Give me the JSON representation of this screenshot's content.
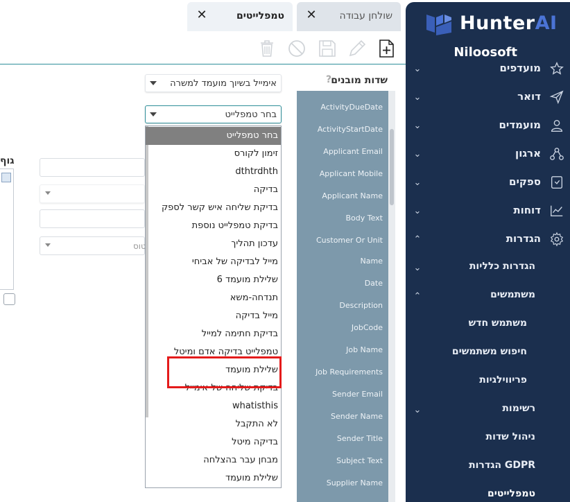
{
  "tabs": [
    {
      "label": "שולחן עבודה",
      "close": "✕"
    },
    {
      "label": "טמפלייטים",
      "close": "✕"
    }
  ],
  "sidebar": {
    "brand": {
      "hunter": "Hunter",
      "ai": "AI"
    },
    "company": "Niloosoft",
    "items": [
      {
        "label": "מועדפים",
        "icon": "star-icon"
      },
      {
        "label": "דואר",
        "icon": "send-icon"
      },
      {
        "label": "מועמדים",
        "icon": "user-icon"
      },
      {
        "label": "ארגון",
        "icon": "org-icon"
      },
      {
        "label": "ספקים",
        "icon": "supplier-icon"
      },
      {
        "label": "דוחות",
        "icon": "chart-icon"
      },
      {
        "label": "הגדרות",
        "icon": "gear-icon"
      },
      {
        "label": "הגדרות כלליות"
      },
      {
        "label": "משתמשים"
      },
      {
        "label": "משתמש חדש"
      },
      {
        "label": "חיפוש משתמשים"
      },
      {
        "label": "פריווילגיות"
      },
      {
        "label": "רשימות"
      },
      {
        "label": "ניהול שדות"
      },
      {
        "label": "הגדרות GDPR"
      },
      {
        "label": "טמפלייטים"
      }
    ]
  },
  "fields": {
    "title": "שדות מובנים",
    "help": "?",
    "items": [
      "ActivityDueDate",
      "ActivityStartDate",
      "Applicant Email",
      "Applicant Mobile",
      "Applicant Name",
      "Body Text",
      "Customer Or Unit",
      "Name",
      "Date",
      "Description",
      "JobCode",
      "Job Name",
      "Job Requirements",
      "Sender Email",
      "Sender Name",
      "Sender Title",
      "Subject Text",
      "Supplier Name"
    ]
  },
  "form": {
    "email_type": "אימייל בשיוך מועמד למשרה",
    "template_select": "בחר טמפלייט",
    "body_label": "גוף",
    "ghost_status": "טוס"
  },
  "dropdown": {
    "items": [
      "בחר טמפלייט",
      "זימון לקורס",
      "dthtrdhth",
      "בדיקה",
      "בדיקת שליחה איש קשר לספק",
      "בדיקת טמפלייט נוספת",
      "עדכון תהליך",
      "מייל לבדיקה של אביחי",
      "שלילת מועמד 6",
      "תנדחה-משא",
      "מייל בדיקה",
      "בדיקת חתימה למייל",
      "טמפלייט בדיקה אדם ומיטל",
      "שלילת מועמד",
      "בדיקת שליחה של אימייל",
      "whatisthis",
      "לא התקבל",
      "בדיקה מיטל",
      "מבחן עבר בהצלחה",
      "שלילת מועמד"
    ],
    "selected_index": 0
  },
  "colors": {
    "sidebar": "#1b2f4e",
    "accent": "#2f8f9a",
    "fields_panel": "#7d99ab",
    "highlight": "#e41b1b",
    "brand_ai": "#4b74d6"
  }
}
